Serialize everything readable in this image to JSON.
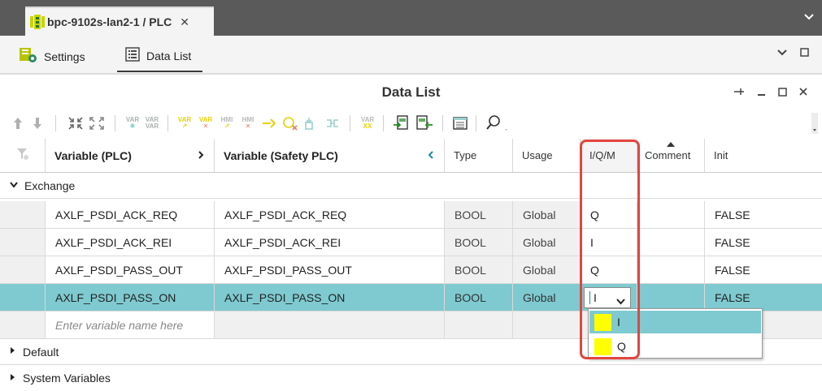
{
  "window": {
    "tab_title": "bpc-9102s-lan2-1 / PLC",
    "close_glyph": "✕",
    "chevron_glyph": "⌄"
  },
  "views": {
    "settings_label": "Settings",
    "datalist_label": "Data List"
  },
  "panel": {
    "title": "Data List"
  },
  "columns": {
    "variable_plc": "Variable (PLC)",
    "variable_safety": "Variable (Safety PLC)",
    "type": "Type",
    "usage": "Usage",
    "iqm": "I/Q/M",
    "comment": "Comment",
    "init": "Init"
  },
  "groups": {
    "exchange": "Exchange",
    "default": "Default",
    "system": "System Variables"
  },
  "rows": [
    {
      "plc": "AXLF_PSDI_ACK_REQ",
      "safety": "AXLF_PSDI_ACK_REQ",
      "type": "BOOL",
      "usage": "Global",
      "iqm": "Q",
      "comment": "",
      "init": "FALSE"
    },
    {
      "plc": "AXLF_PSDI_ACK_REI",
      "safety": "AXLF_PSDI_ACK_REI",
      "type": "BOOL",
      "usage": "Global",
      "iqm": "I",
      "comment": "",
      "init": "FALSE"
    },
    {
      "plc": "AXLF_PSDI_PASS_OUT",
      "safety": "AXLF_PSDI_PASS_OUT",
      "type": "BOOL",
      "usage": "Global",
      "iqm": "Q",
      "comment": "",
      "init": "FALSE"
    },
    {
      "plc": "AXLF_PSDI_PASS_ON",
      "safety": "AXLF_PSDI_PASS_ON",
      "type": "BOOL",
      "usage": "Global",
      "iqm": "I",
      "comment": "",
      "init": "FALSE"
    }
  ],
  "new_row_placeholder": "Enter variable name here",
  "dropdown": {
    "options": [
      "I",
      "Q"
    ],
    "swatch_color": "#ffff00"
  },
  "colors": {
    "selected_row": "#7ecad0",
    "highlight_box": "#e2463f",
    "dropdown_hover": "#7ecad0",
    "titlebar": "#5a5a5a"
  },
  "toolbar": {
    "var_labels": {
      "var": "VAR",
      "xx": "XX",
      "hmi": "HMI"
    }
  }
}
